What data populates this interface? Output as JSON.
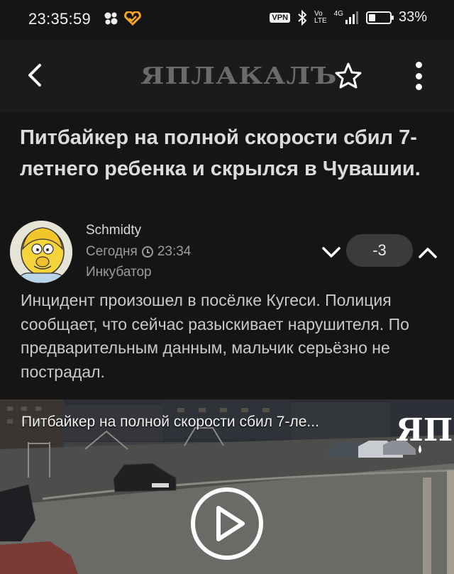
{
  "status_bar": {
    "time": "23:35:59",
    "vpn": "VPN",
    "net_top": "Vo",
    "net_bottom": "LTE",
    "net_type": "4G",
    "battery": "33%",
    "battery_level": 0.33
  },
  "header": {
    "logo": "ЯПЛАКАЛЪ"
  },
  "article": {
    "title": "Питбайкер на полной скорости сбил 7-летнего ребенка и скрылся в Чувашии.",
    "author": "Schmidty",
    "time": "Сегодня 23:34",
    "rank": "Инкубатор",
    "rating": "-3",
    "body": "Инцидент произошел в посёлке Кугеси. Полиция сообщает, что сейчас разыскивает нарушителя. По предварительным данным, мальчик серьёзно не пострадал."
  },
  "video": {
    "title": "Питбайкер на полной скорости сбил 7-ле...",
    "watermark": "ЯП"
  },
  "colors": {
    "background": "#151515",
    "header": "#1b1b1b",
    "rating_pill": "#3b3b3b"
  }
}
